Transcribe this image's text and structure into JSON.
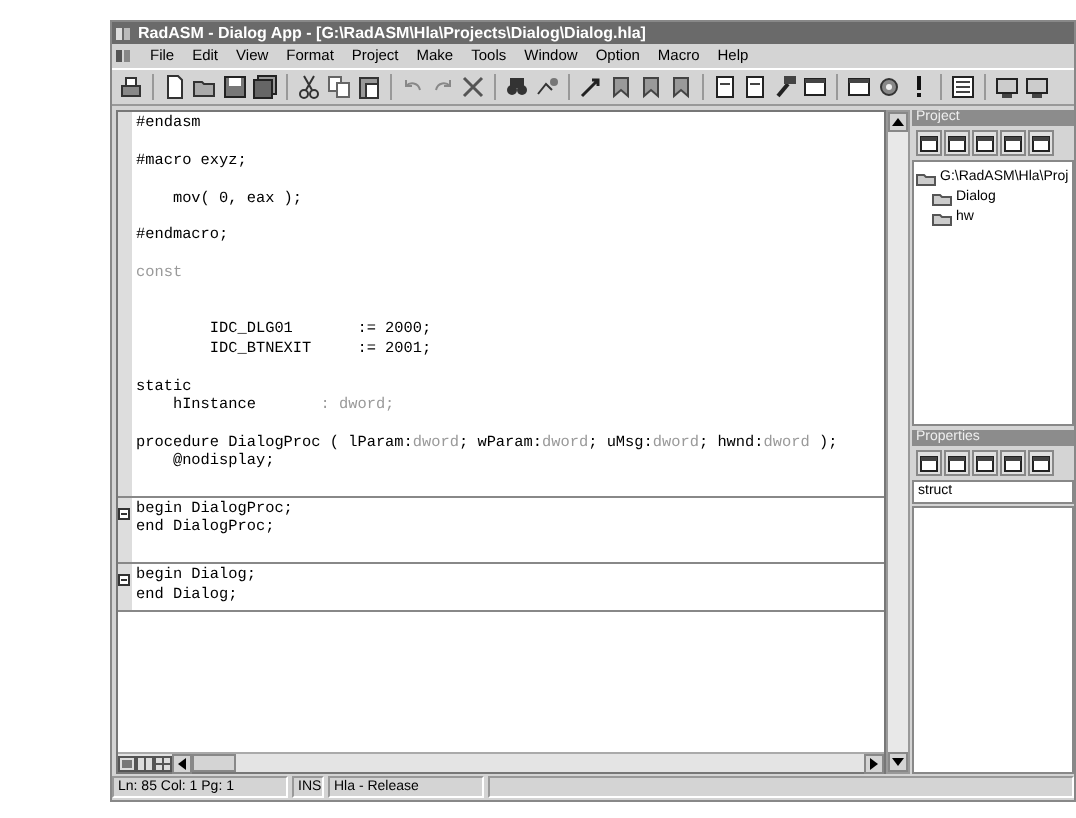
{
  "window": {
    "title": "RadASM - Dialog App - [G:\\RadASM\\Hla\\Projects\\Dialog\\Dialog.hla]"
  },
  "menu": [
    "File",
    "Edit",
    "View",
    "Format",
    "Project",
    "Make",
    "Tools",
    "Window",
    "Option",
    "Macro",
    "Help"
  ],
  "editor": {
    "blocks": [
      {
        "fold_marker": false,
        "lines": [
          {
            "kind": "code",
            "parts": [
              {
                "text": "#endasm",
                "kind": "plain"
              }
            ]
          },
          {
            "kind": "blank"
          },
          {
            "kind": "code",
            "parts": [
              {
                "text": "#macro exyz;",
                "kind": "plain"
              }
            ]
          },
          {
            "kind": "blank"
          },
          {
            "kind": "code",
            "parts": [
              {
                "text": "    mov( 0, eax );",
                "kind": "plain"
              }
            ]
          },
          {
            "kind": "blank"
          },
          {
            "kind": "code",
            "parts": [
              {
                "text": "#endmacro;",
                "kind": "plain"
              }
            ]
          },
          {
            "kind": "blank"
          },
          {
            "kind": "code",
            "parts": [
              {
                "text": "const",
                "kind": "type"
              }
            ]
          },
          {
            "kind": "blank"
          },
          {
            "kind": "blank"
          },
          {
            "kind": "code",
            "parts": [
              {
                "text": "        IDC_DLG01       := 2000;",
                "kind": "plain"
              }
            ]
          },
          {
            "kind": "code",
            "parts": [
              {
                "text": "        IDC_BTNEXIT     := 2001;",
                "kind": "plain"
              }
            ]
          },
          {
            "kind": "blank"
          },
          {
            "kind": "code",
            "parts": [
              {
                "text": "static",
                "kind": "plain"
              }
            ]
          },
          {
            "kind": "code",
            "parts": [
              {
                "text": "    hInstance       ",
                "kind": "plain"
              },
              {
                "text": ": dword;",
                "kind": "type"
              }
            ]
          },
          {
            "kind": "blank"
          },
          {
            "kind": "code",
            "parts": [
              {
                "text": "procedure DialogProc ( lParam:",
                "kind": "plain"
              },
              {
                "text": "dword",
                "kind": "type"
              },
              {
                "text": "; wParam:",
                "kind": "plain"
              },
              {
                "text": "dword",
                "kind": "type"
              },
              {
                "text": "; uMsg:",
                "kind": "plain"
              },
              {
                "text": "dword",
                "kind": "type"
              },
              {
                "text": "; hwnd:",
                "kind": "plain"
              },
              {
                "text": "dword",
                "kind": "type"
              },
              {
                "text": " );",
                "kind": "plain"
              }
            ]
          },
          {
            "kind": "code",
            "parts": [
              {
                "text": "    @nodisplay;",
                "kind": "plain"
              }
            ]
          },
          {
            "kind": "blank"
          }
        ]
      },
      {
        "fold_marker": true,
        "lines": [
          {
            "kind": "code",
            "parts": [
              {
                "text": "begin DialogProc;",
                "kind": "plain"
              }
            ]
          },
          {
            "kind": "code",
            "parts": [
              {
                "text": "end DialogProc;",
                "kind": "plain"
              }
            ]
          },
          {
            "kind": "blank"
          }
        ]
      },
      {
        "fold_marker": true,
        "lines": [
          {
            "kind": "code",
            "parts": [
              {
                "text": "begin Dialog;",
                "kind": "plain"
              }
            ]
          },
          {
            "kind": "code",
            "parts": [
              {
                "text": "end Dialog;",
                "kind": "plain"
              }
            ]
          }
        ]
      }
    ]
  },
  "project": {
    "title": "Project",
    "tree": [
      {
        "label": "G:\\RadASM\\Hla\\Proj",
        "children": [
          {
            "label": "Dialog"
          },
          {
            "label": "hw"
          }
        ]
      }
    ]
  },
  "properties": {
    "title": "Properties",
    "field": "struct"
  },
  "status_bar": [
    "Ln: 85 Col: 1 Pg: 1",
    "INS",
    "Hla - Release"
  ]
}
